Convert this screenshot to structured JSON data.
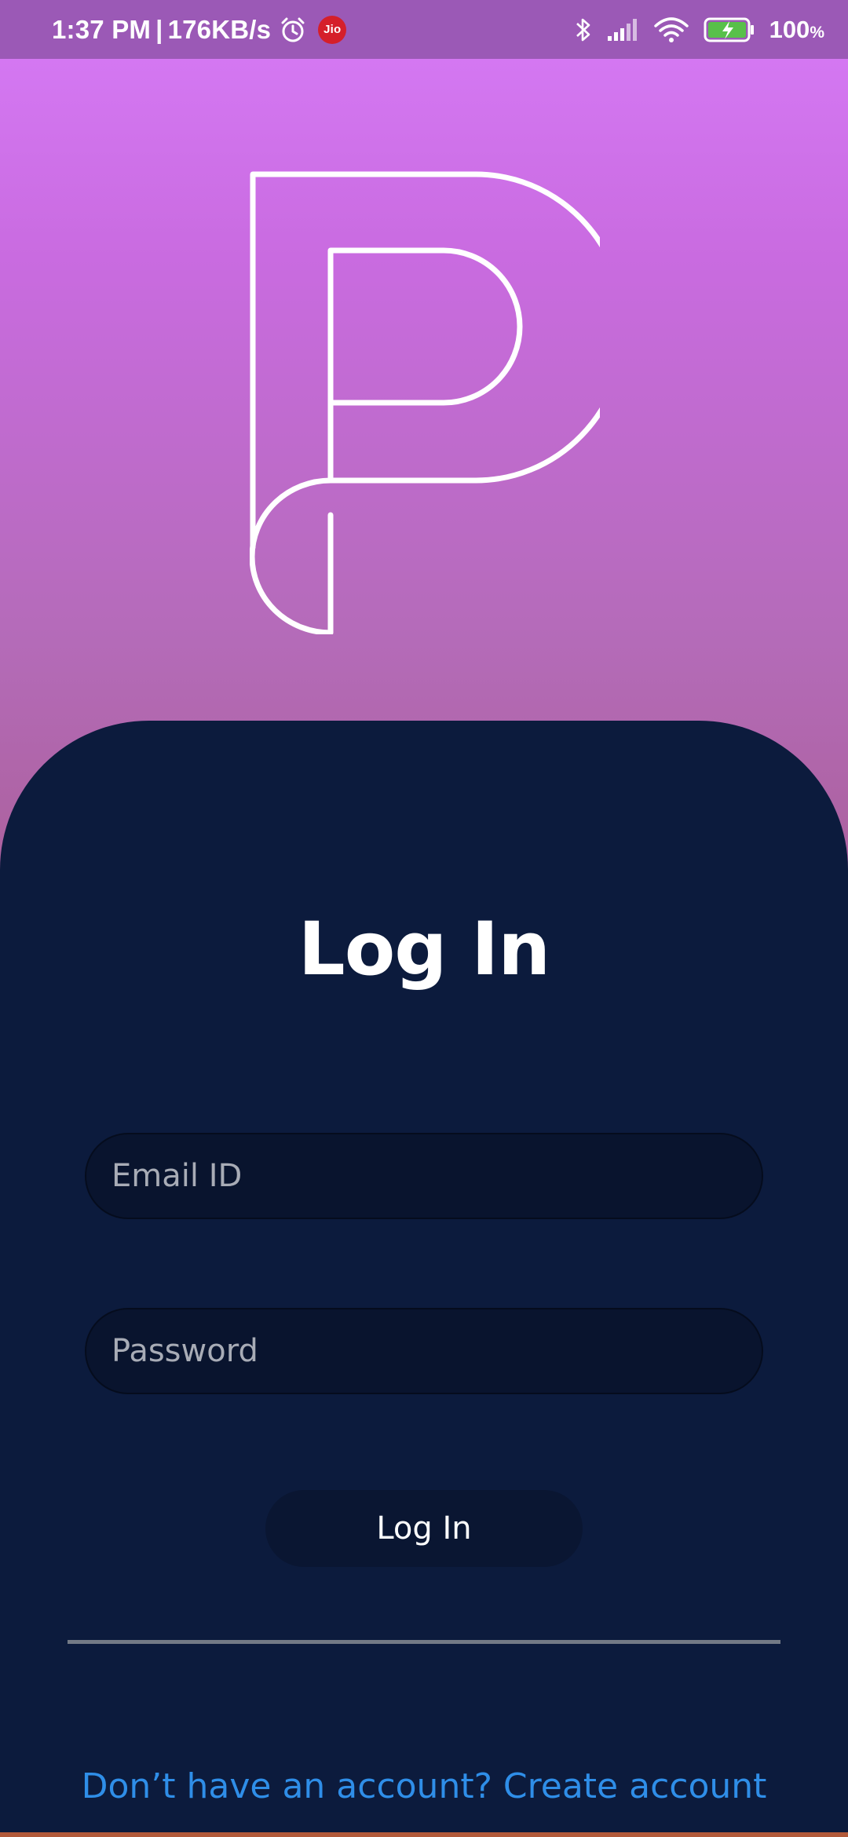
{
  "status_bar": {
    "time": "1:37 PM",
    "separator": "|",
    "network_speed": "176KB/s",
    "carrier_badge": "Jio",
    "battery_percent": "100",
    "battery_unit": "%",
    "icons": [
      "alarm-icon",
      "jio-icon",
      "bluetooth-icon",
      "signal-icon",
      "wifi-icon",
      "battery-charging-icon"
    ]
  },
  "logo": {
    "icon": "p-logo-icon",
    "stroke_color": "#ffffff"
  },
  "login": {
    "title": "Log In",
    "email_placeholder": "Email ID",
    "password_placeholder": "Password",
    "submit_label": "Log In",
    "signup_text": "Don’t have an account? Create account"
  },
  "colors": {
    "gradient_top": "#d77bf7",
    "gradient_bottom": "#c35a87",
    "card_background": "#0c1b3d",
    "input_background": "#09142e",
    "link": "#2f8ee8",
    "status_bar": "#9b59b6"
  }
}
